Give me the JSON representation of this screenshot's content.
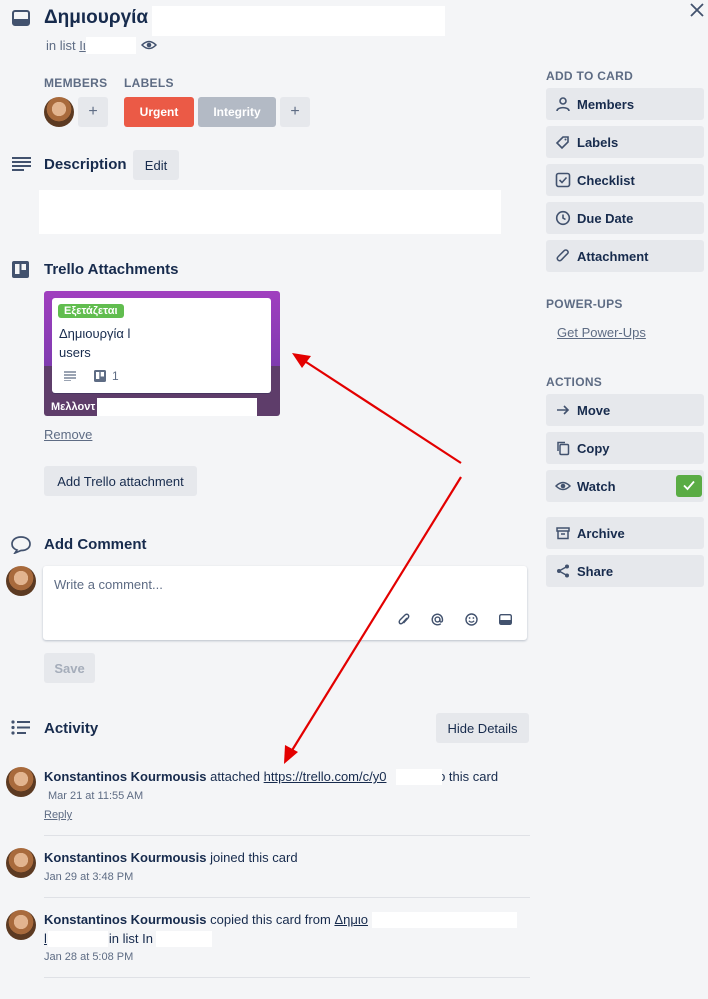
{
  "card": {
    "title": "Δημιουργία",
    "list_prefix": "in list",
    "list_name": "Ιι"
  },
  "members_section": {
    "heading": "MEMBERS",
    "add": "+"
  },
  "labels_section": {
    "heading": "LABELS",
    "items": [
      {
        "text": "Urgent",
        "color": "#eb5a46"
      },
      {
        "text": "Integrity",
        "color": "#b3bac5"
      }
    ],
    "add": "+"
  },
  "description": {
    "title": "Description",
    "edit": "Edit"
  },
  "attachments": {
    "title": "Trello Attachments",
    "card": {
      "badge": "Εξετάζεται",
      "badge_color": "#61bd4f",
      "title_line1": "Δημιουργία l",
      "title_line2": "users",
      "attachment_count": "1",
      "board_name": "Μελλοντ",
      "header_color": "#8e44ad"
    },
    "remove": "Remove",
    "add_button": "Add Trello attachment"
  },
  "comment": {
    "title": "Add Comment",
    "placeholder": "Write a comment...",
    "save": "Save"
  },
  "activity": {
    "title": "Activity",
    "hide_details": "Hide Details",
    "items": [
      {
        "user": "Konstantinos Kourmousis",
        "action": "attached",
        "link": "https://trello.com/c/y0",
        "suffix": "to this card",
        "time": "Mar 21 at 11:55 AM",
        "reply": "Reply"
      },
      {
        "user": "Konstantinos Kourmousis",
        "action": "joined this card",
        "time": "Jan 29 at 3:48 PM"
      },
      {
        "user": "Konstantinos Kourmousis",
        "action": "copied this card from",
        "link": "Δημιο",
        "line2_prefix": "l",
        "line2_list": "in list In",
        "time": "Jan 28 at 5:08 PM"
      }
    ]
  },
  "sidebar": {
    "add_to_card": "ADD TO CARD",
    "add_items": [
      "Members",
      "Labels",
      "Checklist",
      "Due Date",
      "Attachment"
    ],
    "powerups_heading": "POWER-UPS",
    "get_powerups": "Get Power-Ups",
    "actions_heading": "ACTIONS",
    "action_items": [
      "Move",
      "Copy",
      "Watch",
      "Archive",
      "Share"
    ],
    "watch_active_color": "#5aac44"
  },
  "annotation_color": "#e30000"
}
